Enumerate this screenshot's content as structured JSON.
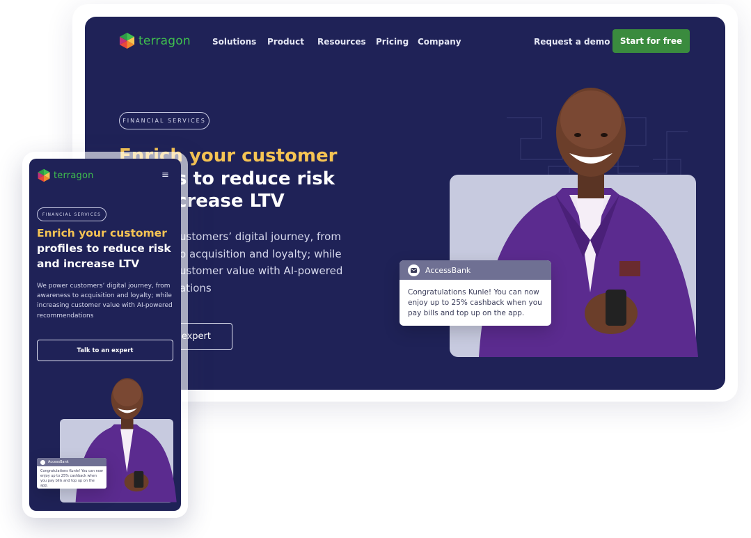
{
  "brand": {
    "name": "terragon"
  },
  "nav": {
    "links": [
      "Solutions",
      "Product",
      "Resources",
      "Pricing",
      "Company"
    ],
    "demo": "Request a demo",
    "cta": "Start for free"
  },
  "hero": {
    "badge": "FINANCIAL SERVICES",
    "title_accent": "Enrich your customer",
    "title_rest_line1": "profiles to reduce risk",
    "title_rest_line2": "and increase LTV",
    "desktop_title_line2": "s to reduce risk",
    "desktop_title_line3": "crease LTV",
    "desktop_desc": [
      "ustomers’ digital journey, from",
      "o acquisition and loyalty; while",
      "ustomer value with AI-powered",
      "ations"
    ],
    "desktop_button": "expert",
    "mobile_desc": "We power customers’ digital journey, from awareness to acquisition and loyalty; while increasing customer value with AI-powered recommendations",
    "mobile_button": "Talk to an expert"
  },
  "notification": {
    "bank": "AccessBank",
    "message": "Congratulations Kunle! You can now enjoy up to 25% cashback when you pay bills and top up on the app."
  },
  "colors": {
    "background": "#1f2257",
    "accent": "#f6c453",
    "brand_green": "#3fbf4e",
    "cta_green": "#3a8b3e"
  },
  "icons": [
    "terragon-logo-icon",
    "menu-icon",
    "envelope-icon"
  ]
}
